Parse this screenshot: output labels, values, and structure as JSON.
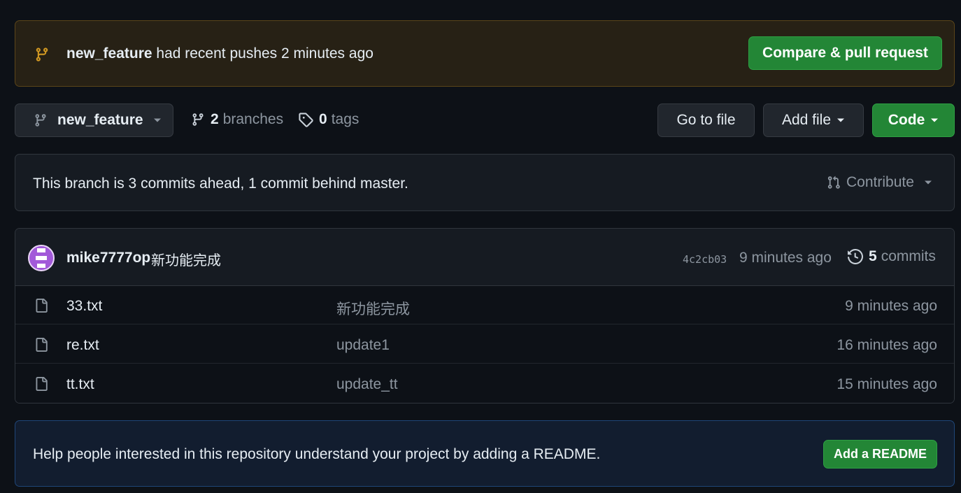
{
  "push_banner": {
    "branch": "new_feature",
    "message": "had recent pushes 2 minutes ago",
    "button_label": "Compare & pull request"
  },
  "toolbar": {
    "branch_selector": "new_feature",
    "branches_count": "2",
    "branches_label": "branches",
    "tags_count": "0",
    "tags_label": "tags",
    "goto_file_label": "Go to file",
    "add_file_label": "Add file",
    "code_label": "Code"
  },
  "branch_status": {
    "text": "This branch is 3 commits ahead, 1 commit behind master.",
    "contribute_label": "Contribute"
  },
  "latest_commit": {
    "author": "mike7777op",
    "message": "新功能完成",
    "sha": "4c2cb03",
    "time": "9 minutes ago",
    "commits_count": "5",
    "commits_label": "commits"
  },
  "files": [
    {
      "name": "33.txt",
      "message": "新功能完成",
      "time": "9 minutes ago",
      "icon": "file-icon"
    },
    {
      "name": "re.txt",
      "message": "update1",
      "time": "16 minutes ago",
      "icon": "file-icon"
    },
    {
      "name": "tt.txt",
      "message": "update_tt",
      "time": "15 minutes ago",
      "icon": "file-icon"
    }
  ],
  "readme_prompt": {
    "text": "Help people interested in this repository understand your project by adding a README.",
    "button_label": "Add a README"
  },
  "colors": {
    "background": "#0d1117",
    "accent_green": "#238636",
    "banner_warning": "#d29922",
    "muted_text": "#8d96a0"
  }
}
